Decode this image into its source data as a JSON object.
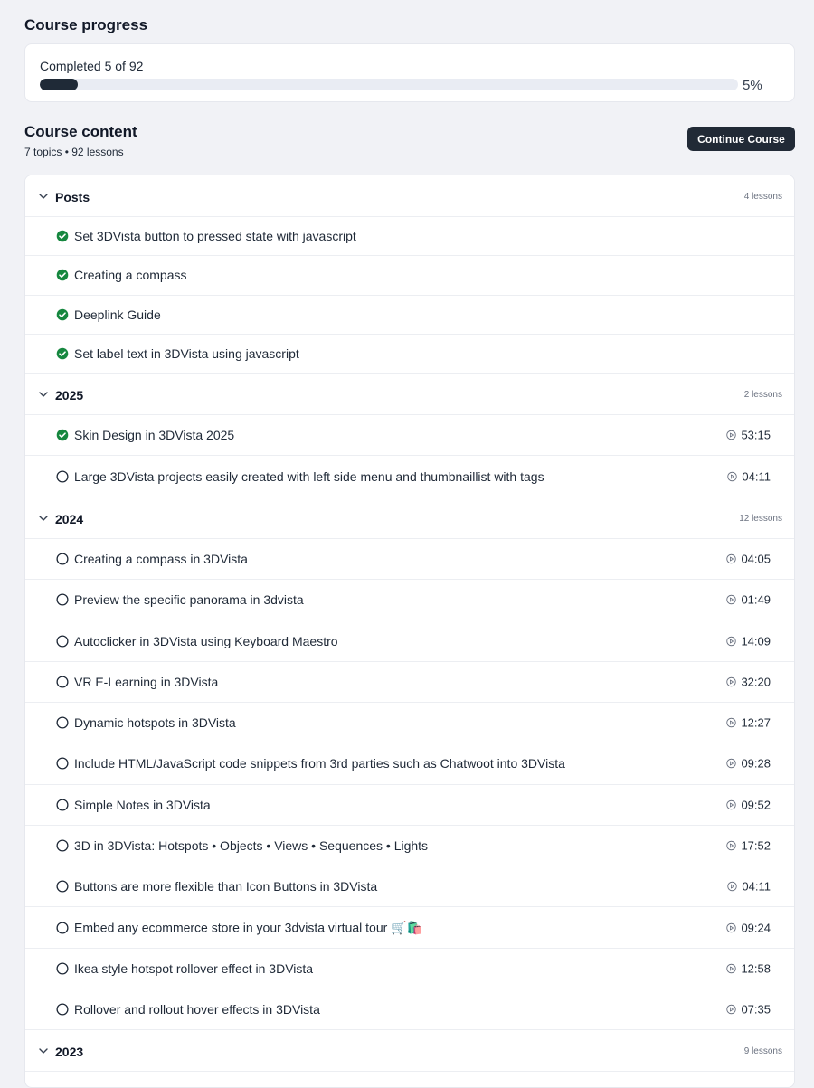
{
  "progress": {
    "title": "Course progress",
    "label": "Completed 5 of 92",
    "completed": 5,
    "total": 92,
    "percent_text": "5%",
    "fill_color": "#1f2a37"
  },
  "content": {
    "title": "Course content",
    "subtitle": "7 topics • 92 lessons",
    "continue_label": "Continue Course"
  },
  "colors": {
    "done": "#16873f",
    "accent": "#212a36"
  },
  "topics": [
    {
      "name": "Posts",
      "count": "4 lessons",
      "lessons": [
        {
          "title": "Set 3DVista button to pressed state with javascript",
          "done": true,
          "duration": ""
        },
        {
          "title": "Creating a compass",
          "done": true,
          "duration": ""
        },
        {
          "title": "Deeplink Guide",
          "done": true,
          "duration": ""
        },
        {
          "title": "Set label text in 3DVista using javascript",
          "done": true,
          "duration": ""
        }
      ]
    },
    {
      "name": "2025",
      "count": "2 lessons",
      "lessons": [
        {
          "title": "Skin Design in 3DVista 2025",
          "done": true,
          "duration": "53:15"
        },
        {
          "title": "Large 3DVista projects easily created with left side menu and thumbnaillist with tags",
          "done": false,
          "duration": "04:11"
        }
      ]
    },
    {
      "name": "2024",
      "count": "12 lessons",
      "lessons": [
        {
          "title": "Creating a compass in 3DVista",
          "done": false,
          "duration": "04:05"
        },
        {
          "title": "Preview the specific panorama in 3dvista",
          "done": false,
          "duration": "01:49"
        },
        {
          "title": "Autoclicker in 3DVista using Keyboard Maestro",
          "done": false,
          "duration": "14:09"
        },
        {
          "title": "VR E-Learning in 3DVista",
          "done": false,
          "duration": "32:20"
        },
        {
          "title": "Dynamic hotspots in 3DVista",
          "done": false,
          "duration": "12:27"
        },
        {
          "title": "Include HTML/JavaScript code snippets from 3rd parties such as Chatwoot into 3DVista",
          "done": false,
          "duration": "09:28"
        },
        {
          "title": "Simple Notes in 3DVista",
          "done": false,
          "duration": "09:52"
        },
        {
          "title": "3D in 3DVista: Hotspots • Objects • Views • Sequences • Lights",
          "done": false,
          "duration": "17:52"
        },
        {
          "title": "Buttons are more flexible than Icon Buttons in 3DVista",
          "done": false,
          "duration": "04:11"
        },
        {
          "title": "Embed any ecommerce store in your 3dvista virtual tour 🛒🛍️",
          "done": false,
          "duration": "09:24"
        },
        {
          "title": "Ikea style hotspot rollover effect in 3DVista",
          "done": false,
          "duration": "12:58"
        },
        {
          "title": "Rollover and rollout hover effects in 3DVista",
          "done": false,
          "duration": "07:35"
        }
      ]
    },
    {
      "name": "2023",
      "count": "9 lessons",
      "lessons": []
    }
  ]
}
